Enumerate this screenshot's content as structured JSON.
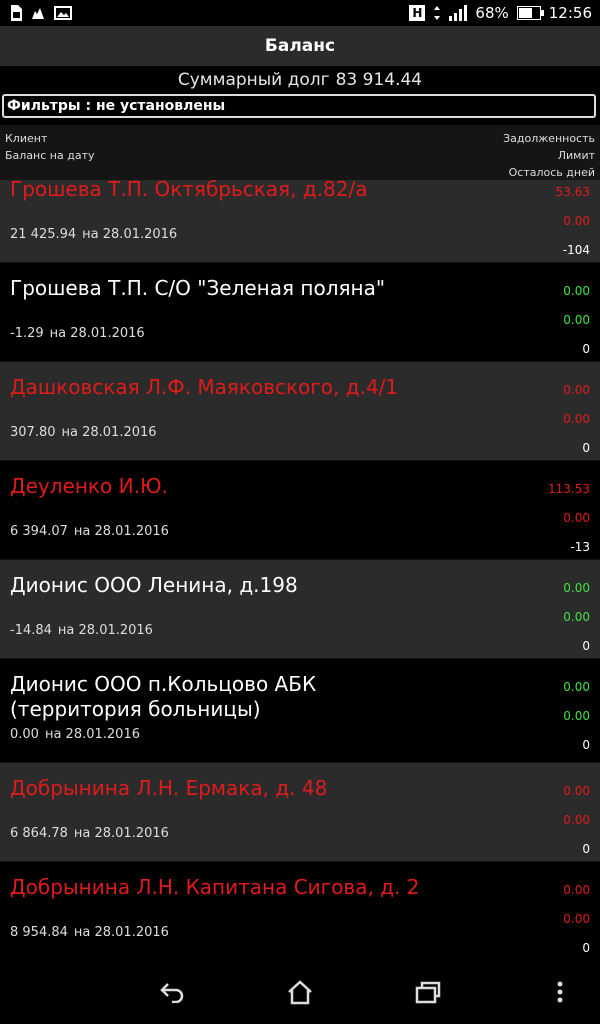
{
  "status_bar": {
    "left_icons": [
      "sim-card-icon",
      "cat-icon",
      "image-icon"
    ],
    "battery_percent": "68%",
    "time": "12:56",
    "h_label": "H"
  },
  "title": "Баланс",
  "summary": {
    "label": "Суммарный долг",
    "value": "83 914.44"
  },
  "filter": {
    "label": "Фильтры : не установлены"
  },
  "header": {
    "left": [
      "Клиент",
      "Баланс на дату"
    ],
    "right": [
      "Задолженность",
      "Лимит",
      "Осталось дней"
    ]
  },
  "rows": [
    {
      "name": "Грошева Т.П. Октябрьская, д.82/а",
      "name_color": "red",
      "balance": "21 425.94",
      "date_text": "на 28.01.2016",
      "debt": "53.63",
      "limit": "0.00",
      "days": "-104",
      "debt_color": "red",
      "limit_color": "red",
      "bg": "gray"
    },
    {
      "name": "Грошева Т.П. С/О \"Зеленая поляна\"",
      "name_color": "white",
      "balance": "-1.29",
      "date_text": "на 28.01.2016",
      "debt": "0.00",
      "limit": "0.00",
      "days": "0",
      "debt_color": "green",
      "limit_color": "green",
      "bg": "black"
    },
    {
      "name": "Дашковская Л.Ф. Маяковского, д.4/1",
      "name_color": "red",
      "balance": "307.80",
      "date_text": "на 28.01.2016",
      "debt": "0.00",
      "limit": "0.00",
      "days": "0",
      "debt_color": "red",
      "limit_color": "red",
      "bg": "gray"
    },
    {
      "name": "Деуленко И.Ю.",
      "name_color": "red",
      "balance": "6 394.07",
      "date_text": "на 28.01.2016",
      "debt": "113.53",
      "limit": "0.00",
      "days": "-13",
      "debt_color": "red",
      "limit_color": "red",
      "bg": "black"
    },
    {
      "name": "Дионис ООО Ленина, д.198",
      "name_color": "white",
      "balance": "-14.84",
      "date_text": "на 28.01.2016",
      "debt": "0.00",
      "limit": "0.00",
      "days": "0",
      "debt_color": "green",
      "limit_color": "green",
      "bg": "gray"
    },
    {
      "name": "Дионис ООО п.Кольцово АБК (территория больницы)",
      "name_color": "white",
      "balance": "0.00",
      "date_text": "на 28.01.2016",
      "debt": "0.00",
      "limit": "0.00",
      "days": "0",
      "debt_color": "green",
      "limit_color": "green",
      "bg": "black",
      "tall": true
    },
    {
      "name": "Добрынина Л.Н. Ермака, д. 48",
      "name_color": "red",
      "balance": "6 864.78",
      "date_text": "на 28.01.2016",
      "debt": "0.00",
      "limit": "0.00",
      "days": "0",
      "debt_color": "red",
      "limit_color": "red",
      "bg": "gray"
    },
    {
      "name": "Добрынина Л.Н. Капитана Сигова, д. 2",
      "name_color": "red",
      "balance": "8 954.84",
      "date_text": "на 28.01.2016",
      "debt": "0.00",
      "limit": "0.00",
      "days": "0",
      "debt_color": "red",
      "limit_color": "red",
      "bg": "black"
    }
  ],
  "nav_bar": {
    "buttons": [
      "back-icon",
      "home-icon",
      "recents-icon",
      "more-icon"
    ]
  },
  "colors": {
    "red": "#e01b1b",
    "green": "#3fe33f",
    "title_bg": "#2b2b2b"
  }
}
